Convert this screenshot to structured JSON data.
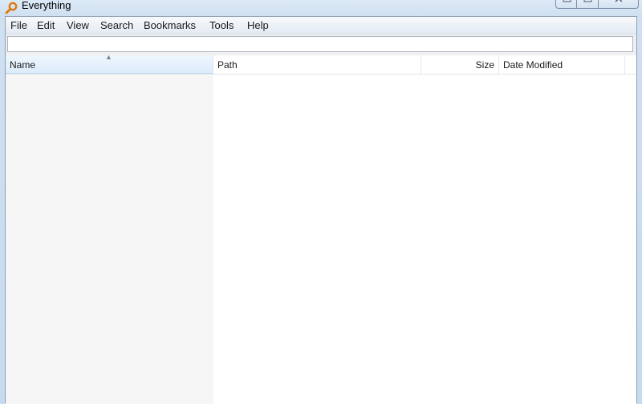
{
  "window": {
    "title": "Everything",
    "icon": "magnifier-key-icon"
  },
  "menu": {
    "items": [
      "File",
      "Edit",
      "View",
      "Search",
      "Bookmarks",
      "Tools",
      "Help"
    ]
  },
  "search": {
    "value": "",
    "placeholder": ""
  },
  "results": {
    "columns": [
      {
        "label": "Name",
        "sorted": "ascending"
      },
      {
        "label": "Path"
      },
      {
        "label": "Size"
      },
      {
        "label": "Date Modified"
      }
    ],
    "rows": []
  },
  "colors": {
    "accent": "#dcecfb",
    "window_frame": "#c7dbef"
  }
}
